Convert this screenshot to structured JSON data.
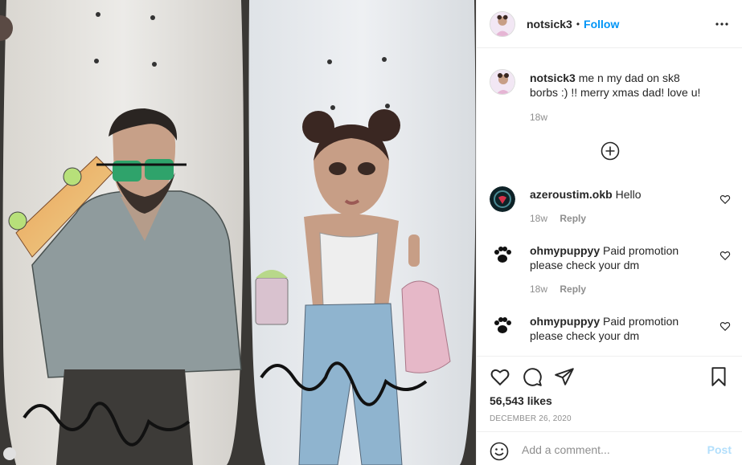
{
  "post": {
    "image_description_hidden": "",
    "author": {
      "username": "notsick3"
    },
    "header": {
      "dot": "•",
      "follow_label": "Follow"
    },
    "caption": {
      "username": "notsick3",
      "text": "me n my dad on sk8 borbs :) !! merry xmas dad! love u!",
      "age": "18w"
    },
    "comments": [
      {
        "username": "azeroustim.okb",
        "text": "Hello",
        "age": "18w",
        "reply_label": "Reply"
      },
      {
        "username": "ohmypuppyy",
        "text": "Paid promotion please check your dm",
        "age": "18w",
        "reply_label": "Reply"
      },
      {
        "username": "ohmypuppyy",
        "text": "Paid promotion please check your dm"
      }
    ],
    "likes": "56,543 likes",
    "date": "DECEMBER 26, 2020",
    "add_comment": {
      "placeholder": "Add a comment...",
      "post_label": "Post"
    },
    "icons": {
      "more": "more-options-icon",
      "load_more": "plus-circle-icon",
      "like": "heart-icon",
      "comment": "comment-bubble-icon",
      "share": "paper-plane-icon",
      "save": "bookmark-icon",
      "emoji": "smiley-icon"
    },
    "colors": {
      "link": "#0095f6",
      "post_disabled": "#b2dffc",
      "muted": "#8e8e8e",
      "text": "#262626"
    }
  }
}
